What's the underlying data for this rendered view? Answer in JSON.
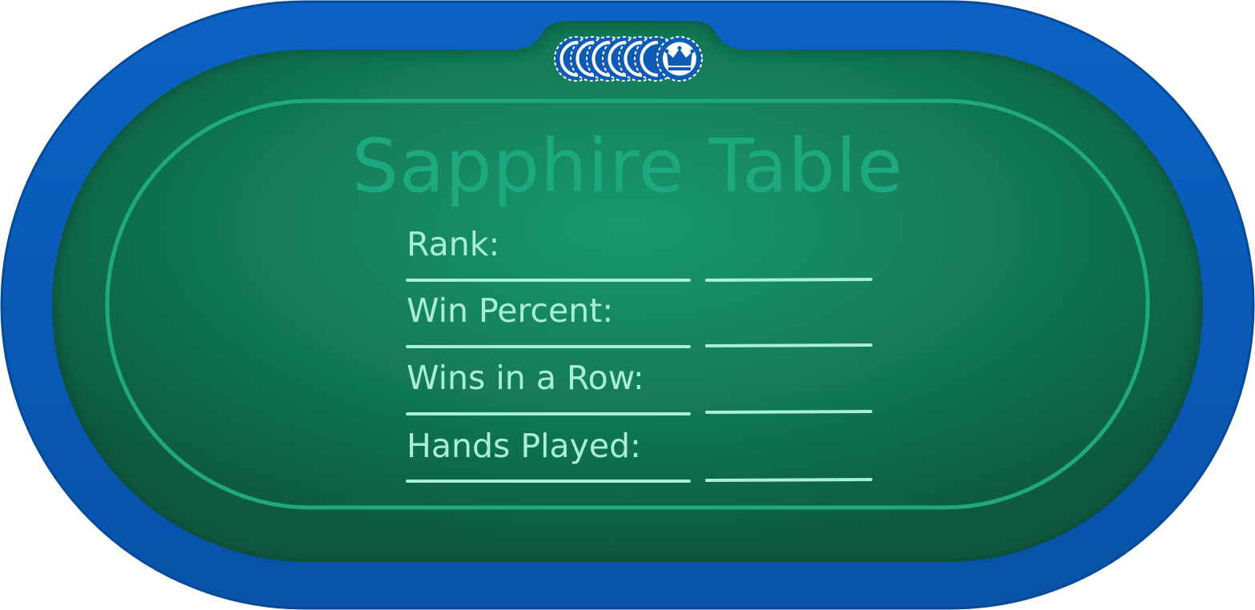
{
  "table": {
    "title": "Sapphire Table",
    "rail_color": "#0a5cb8",
    "felt_color": "#127a57",
    "line_color": "#20a97c"
  },
  "stats": {
    "rows": [
      {
        "label": "Rank:",
        "value": ""
      },
      {
        "label": "Win Percent:",
        "value": ""
      },
      {
        "label": "Wins in a Row:",
        "value": ""
      },
      {
        "label": "Hands Played:",
        "value": ""
      }
    ]
  },
  "chips": {
    "icon": "crown-icon",
    "chip_color": "#0d5bb5"
  }
}
